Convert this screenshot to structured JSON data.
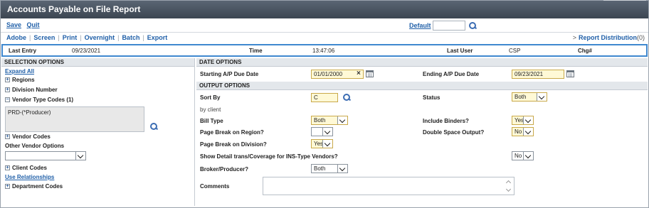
{
  "window": {
    "title": "Accounts Payable on File Report"
  },
  "actions": {
    "save": "Save",
    "quit": "Quit"
  },
  "default_field": {
    "label": "Default",
    "value": ""
  },
  "toolbar": {
    "adobe": "Adobe",
    "screen": "Screen",
    "print": "Print",
    "overnight": "Overnight",
    "batch": "Batch",
    "export": "Export",
    "separator": "|"
  },
  "report_distribution": {
    "chevron": ">",
    "label": "Report Distribution",
    "count": "(0)"
  },
  "last_entry": {
    "label": "Last Entry",
    "date": "09/23/2021",
    "time_label": "Time",
    "time": "13:47:06",
    "user_label": "Last User",
    "user": "CSP",
    "chg_label": "Chg#"
  },
  "selection": {
    "header": "SELECTION OPTIONS",
    "expand_all": "Expand All",
    "regions": "Regions",
    "division_number": "Division Number",
    "vendor_type_codes": "Vendor Type Codes (1)",
    "vendor_type_list": [
      "PRD-(*Producer)"
    ],
    "vendor_codes": "Vendor Codes",
    "other_vendor_options": "Other Vendor Options",
    "other_vendor_value": "",
    "client_codes": "Client Codes",
    "use_relationships": "Use Relationships",
    "department_codes": "Department Codes",
    "plus": "+",
    "minus": "−"
  },
  "date_options": {
    "header": "DATE OPTIONS",
    "start_label": "Starting A/P Due Date",
    "start_value": "01/01/2000",
    "clear": "×",
    "end_label": "Ending A/P Due Date",
    "end_value": "09/23/2021"
  },
  "output_options": {
    "header": "OUTPUT OPTIONS",
    "sort_by_label": "Sort By",
    "sort_by_value": "C",
    "sort_by_desc": "by client",
    "status_label": "Status",
    "status_value": "Both",
    "bill_type_label": "Bill Type",
    "bill_type_value": "Both",
    "include_binders_label": "Include Binders?",
    "include_binders_value": "Yes",
    "page_break_region_label": "Page Break on Region?",
    "page_break_region_value": "",
    "double_space_label": "Double Space Output?",
    "double_space_value": "No",
    "page_break_division_label": "Page Break on Division?",
    "page_break_division_value": "Yes",
    "show_detail_label": "Show Detail trans/Coverage for INS-Type Vendors?",
    "show_detail_value": "No",
    "broker_label": "Broker/Producer?",
    "broker_value": "Both",
    "comments_label": "Comments",
    "comments_value": ""
  }
}
